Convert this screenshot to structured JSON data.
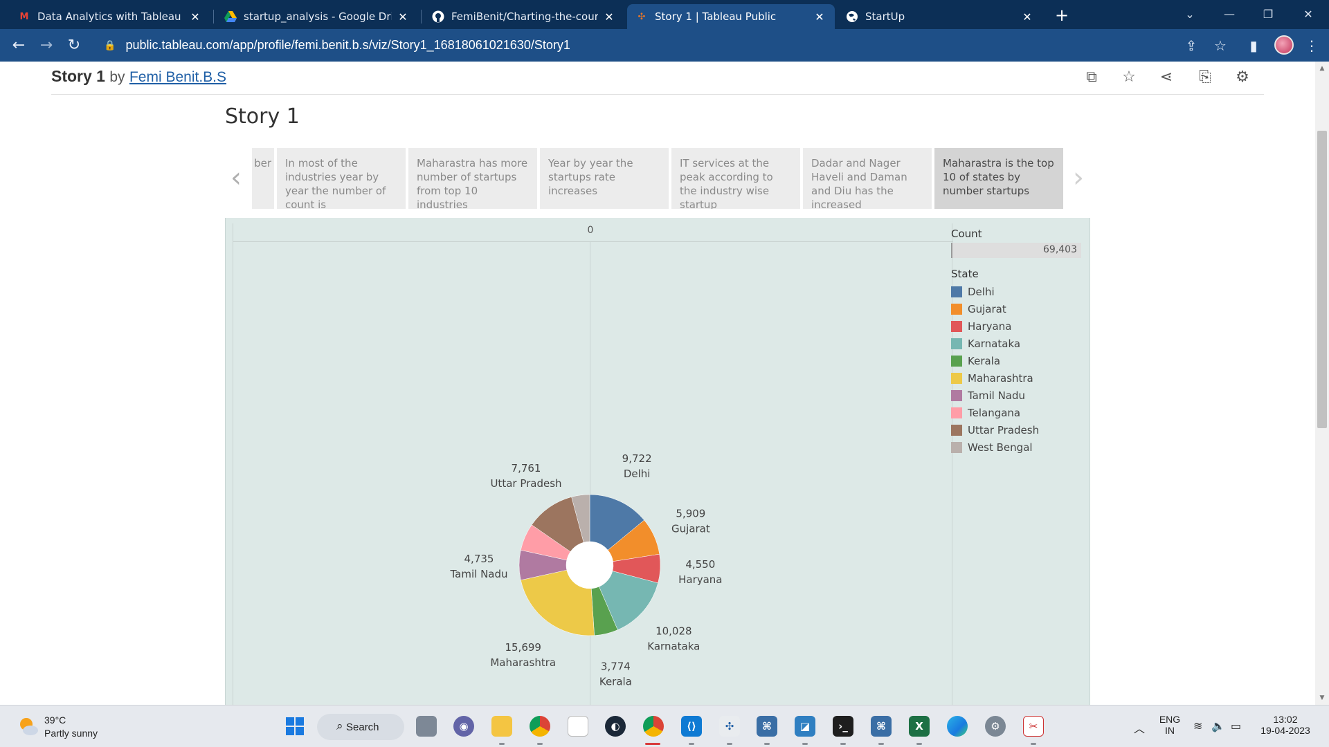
{
  "browser": {
    "tabs": [
      {
        "title": "Data Analytics with Tableau - AM",
        "favicon": "gmail-icon"
      },
      {
        "title": "startup_analysis - Google Drive",
        "favicon": "google-drive-icon"
      },
      {
        "title": "FemiBenit/Charting-the-course-c",
        "favicon": "github-icon"
      },
      {
        "title": "Story 1 | Tableau Public",
        "favicon": "tableau-icon"
      },
      {
        "title": "StartUp",
        "favicon": "globe-icon"
      }
    ],
    "url": "public.tableau.com/app/profile/femi.benit.b.s/viz/Story1_16818061021630/Story1"
  },
  "viz_header": {
    "title": "Story 1",
    "by": "by",
    "author": "Femi Benit.B.S"
  },
  "story": {
    "title": "Story 1",
    "points": [
      {
        "text": "ber"
      },
      {
        "text": "In most of the industries year by year the number of count is"
      },
      {
        "text": "Maharastra has more number of startups from top 10 industries"
      },
      {
        "text": "Year by year the startups rate increases"
      },
      {
        "text": "IT services at the peak according to the industry wise startup"
      },
      {
        "text": "Dadar and Nager Haveli and Daman and Diu has the increased"
      },
      {
        "text": "Maharastra is the top 10 of  states by number startups"
      }
    ]
  },
  "legend": {
    "count_title": "Count",
    "count_value": "69,403",
    "state_title": "State"
  },
  "chart_data": {
    "type": "pie",
    "axis_tick": "0",
    "title": "",
    "categories": [
      "Delhi",
      "Gujarat",
      "Haryana",
      "Karnataka",
      "Kerala",
      "Maharashtra",
      "Tamil Nadu",
      "Telangana",
      "Uttar Pradesh",
      "West Bengal"
    ],
    "values": [
      9722,
      5909,
      4550,
      10028,
      3774,
      15699,
      4735,
      4340,
      7761,
      2885
    ],
    "value_labels": [
      "9,722",
      "5,909",
      "4,550",
      "10,028",
      "3,774",
      "15,699",
      "4,735",
      "",
      "7,761",
      ""
    ],
    "colors": [
      "#4e79a7",
      "#f28e2b",
      "#e15759",
      "#76b7b2",
      "#59a14f",
      "#edc948",
      "#b07aa1",
      "#ff9da7",
      "#9c755f",
      "#bab0ac"
    ],
    "donut": true,
    "legend_position": "right"
  },
  "taskbar": {
    "weather_temp": "39°C",
    "weather_desc": "Partly sunny",
    "search_label": "Search",
    "lang_top": "ENG",
    "lang_bottom": "IN",
    "time": "13:02",
    "date": "19-04-2023"
  }
}
